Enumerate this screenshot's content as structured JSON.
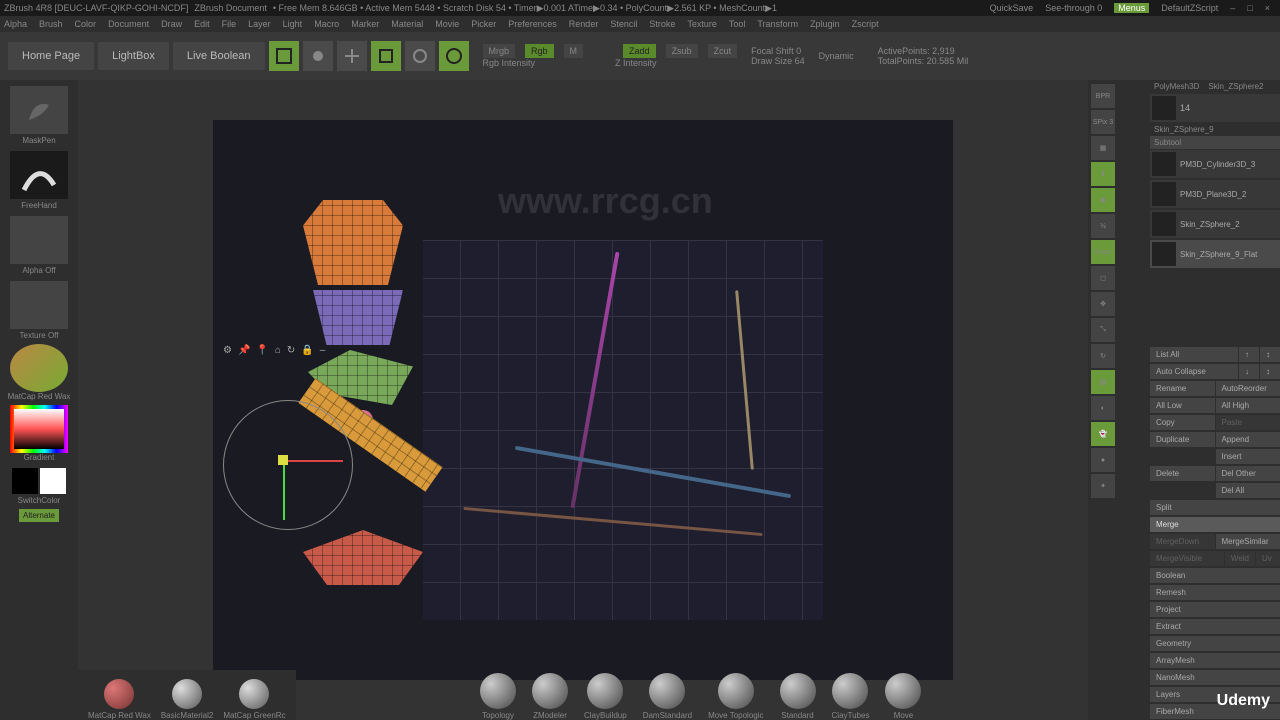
{
  "titlebar": {
    "app": "ZBrush 4R8 [DEUC-LAVF-QIKP-GOHI-NCDF]",
    "doc": "ZBrush Document",
    "stats": "• Free Mem 8.646GB • Active Mem 5448 • Scratch Disk 54 • Timer▶0.001 ATime▶0.34 • PolyCount▶2.561 KP • MeshCount▶1",
    "quicksave": "QuickSave",
    "seethrough": "See-through 0",
    "menus": "Menus",
    "defaultzscript": "DefaultZScript"
  },
  "menubar": [
    "Alpha",
    "Brush",
    "Color",
    "Document",
    "Draw",
    "Edit",
    "File",
    "Layer",
    "Light",
    "Macro",
    "Marker",
    "Material",
    "Movie",
    "Picker",
    "Preferences",
    "Render",
    "Stencil",
    "Stroke",
    "Texture",
    "Tool",
    "Transform",
    "Zplugin",
    "Zscript"
  ],
  "topcontrols": {
    "homepage": "Home Page",
    "lightbox": "LightBox",
    "liveboolean": "Live Boolean",
    "mrgb": "Mrgb",
    "rgb": "Rgb",
    "m": "M",
    "rgbintensity": "Rgb Intensity",
    "zadd": "Zadd",
    "zsub": "Zsub",
    "zcut": "Zcut",
    "zintensity": "Z Intensity",
    "focalshift": "Focal Shift 0",
    "drawsize": "Draw Size 64",
    "dynamic": "Dynamic",
    "activepoints": "ActivePoints: 2,919",
    "totalpoints": "TotalPoints: 20.585 Mil"
  },
  "leftpanel": {
    "brush": "MaskPen",
    "stroke": "FreeHand",
    "alpha": "Alpha Off",
    "texture": "Texture Off",
    "material": "MatCap Red Wax",
    "gradient": "Gradient",
    "switchcolor": "SwitchColor",
    "alternate": "Alternate"
  },
  "rightcol": {
    "spix": "SPix 3",
    "items": [
      "BPR",
      "Draw",
      "Persp",
      "Floor",
      "Local",
      "AAHalf",
      "Xpose",
      "Frame",
      "Move",
      "Scale",
      "Rotate",
      "PolyF",
      "Transp",
      "Ghost",
      "Solo",
      "Xpose"
    ]
  },
  "rightpanel": {
    "top_tabs": [
      "PolyMesh3D",
      "Skin_ZSphere2"
    ],
    "count": "14",
    "current": "Skin_ZSphere_9",
    "section_subtool": "Subtool",
    "subtools": [
      {
        "name": "PM3D_Cylinder3D_3"
      },
      {
        "name": "PM3D_Plane3D_2"
      },
      {
        "name": "Skin_ZSphere_2"
      },
      {
        "name": "Skin_ZSphere_9_Flat"
      }
    ],
    "listall": "List All",
    "autocollapse": "Auto Collapse",
    "rename": "Rename",
    "autoreorder": "AutoReorder",
    "alllow": "All Low",
    "allhigh": "All High",
    "copy": "Copy",
    "paste": "Paste",
    "duplicate": "Duplicate",
    "append": "Append",
    "insert": "Insert",
    "delete": "Delete",
    "delother": "Del Other",
    "delall": "Del All",
    "split": "Split",
    "merge": "Merge",
    "mergedown": "MergeDown",
    "mergesimilar": "MergeSimilar",
    "mergevisible": "MergeVisible",
    "weld": "Weld",
    "uv": "Uv",
    "boolean": "Boolean",
    "remesh": "Remesh",
    "project": "Project",
    "extract": "Extract",
    "geometry": "Geometry",
    "arraymesh": "ArrayMesh",
    "nanomesh": "NanoMesh",
    "layers": "Layers",
    "fibermesh": "FiberMesh"
  },
  "bottom_materials": [
    {
      "name": "MatCap Red Wax"
    },
    {
      "name": "BasicMaterial2"
    },
    {
      "name": "MatCap GreenRc"
    }
  ],
  "bottom_brushes": [
    {
      "name": "Topology"
    },
    {
      "name": "ZModeler"
    },
    {
      "name": "ClayBuildup"
    },
    {
      "name": "DamStandard"
    },
    {
      "name": "Move Topologic"
    },
    {
      "name": "Standard"
    },
    {
      "name": "ClayTubes"
    },
    {
      "name": "Move"
    }
  ],
  "udemy": "Udemy",
  "watermark_url": "www.rrcg.cn"
}
